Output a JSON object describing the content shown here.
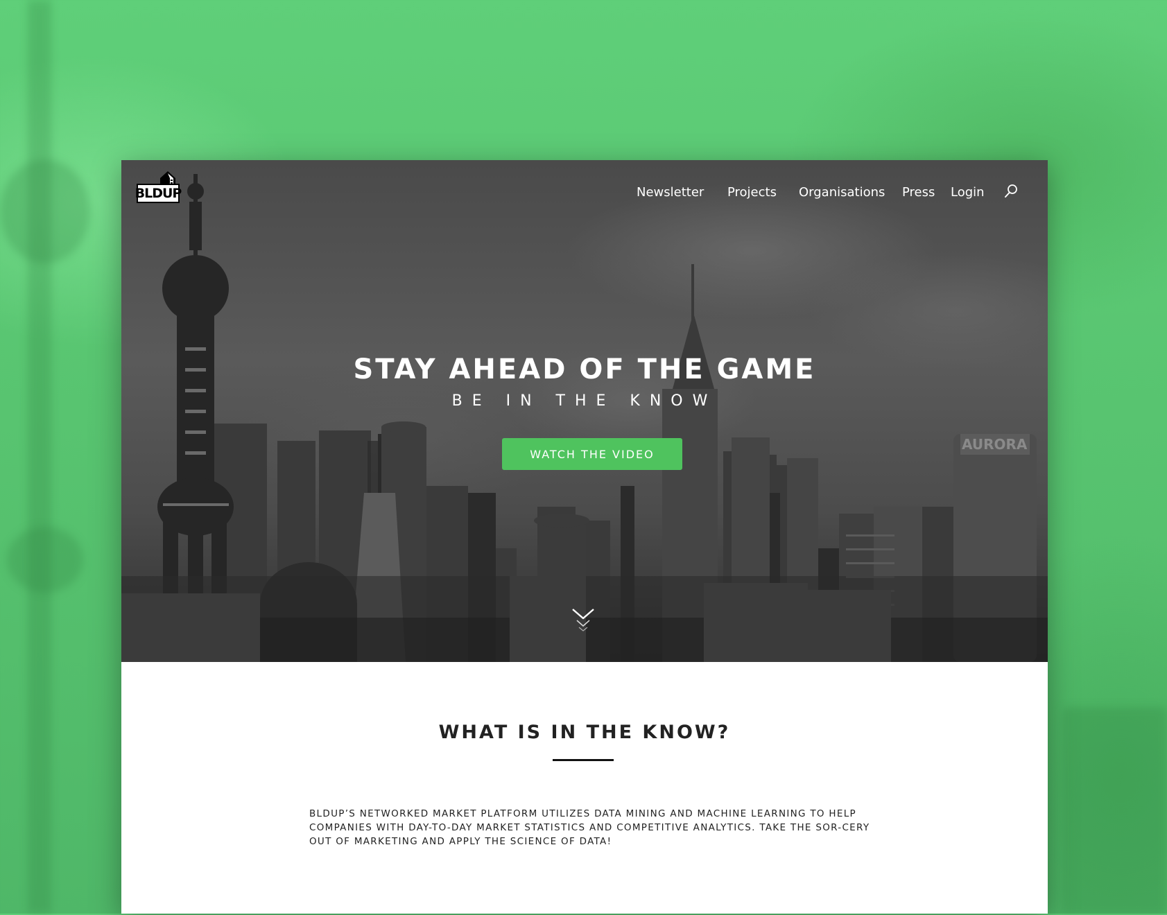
{
  "header": {
    "logo_text": "BLDUP",
    "nav": [
      "Newsletter",
      "Projects",
      "Organisations",
      "Press",
      "Login"
    ]
  },
  "hero": {
    "title": "STAY AHEAD OF THE GAME",
    "subtitle": "BE IN THE KNOW",
    "cta_label": "WATCH THE VIDEO",
    "skyline_sign": "AURORA"
  },
  "about": {
    "heading_light": "WHAT IS ",
    "heading_bold": "IN THE KNOW?",
    "body": "BLDUP’S NETWORKED MARKET PLATFORM UTILIZES DATA MINING AND MACHINE LEARNING TO HELP COMPANIES WITH DAY-TO-DAY MARKET STATISTICS AND COMPETITIVE ANALYTICS. TAKE THE SOR-CERY OUT OF MARKETING AND APPLY THE SCIENCE OF DATA!"
  },
  "colors": {
    "backdrop_green": "#5cc874",
    "cta_green": "#4fc35e",
    "hero_overlay": "#4a4a4a"
  },
  "icons": {
    "search": "search-icon",
    "scroll": "chevron-down-icon",
    "logo": "building-logo-icon"
  }
}
